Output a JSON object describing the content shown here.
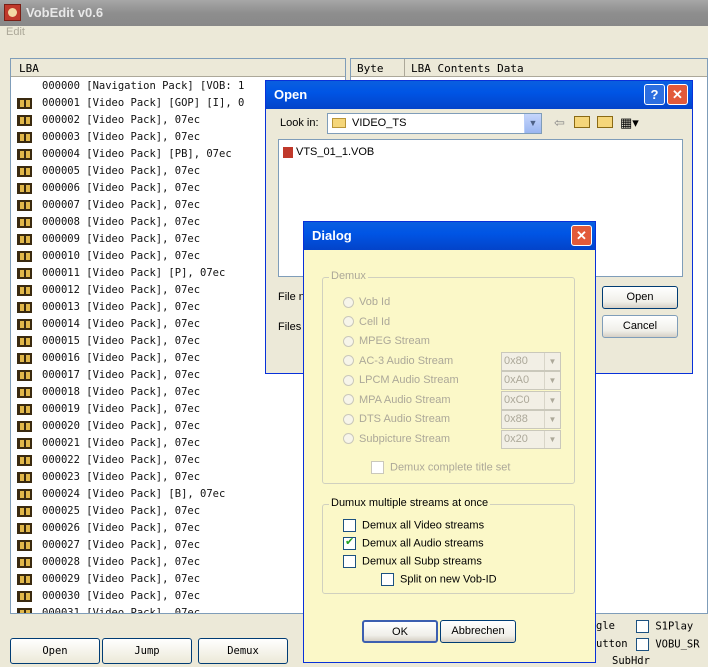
{
  "app": {
    "title": "VobEdit v0.6",
    "menu": [
      "Edit"
    ]
  },
  "list": {
    "header": "LBA",
    "rows": [
      "000000 [Navigation Pack] [VOB: 1",
      "000001 [Video Pack] [GOP] [I], 0",
      "000002 [Video Pack], 07ec",
      "000003 [Video Pack], 07ec",
      "000004 [Video Pack] [PB], 07ec",
      "000005 [Video Pack], 07ec",
      "000006 [Video Pack], 07ec",
      "000007 [Video Pack], 07ec",
      "000008 [Video Pack], 07ec",
      "000009 [Video Pack], 07ec",
      "000010 [Video Pack], 07ec",
      "000011 [Video Pack] [P], 07ec",
      "000012 [Video Pack], 07ec",
      "000013 [Video Pack], 07ec",
      "000014 [Video Pack], 07ec",
      "000015 [Video Pack], 07ec",
      "000016 [Video Pack], 07ec",
      "000017 [Video Pack], 07ec",
      "000018 [Video Pack], 07ec",
      "000019 [Video Pack], 07ec",
      "000020 [Video Pack], 07ec",
      "000021 [Video Pack], 07ec",
      "000022 [Video Pack], 07ec",
      "000023 [Video Pack], 07ec",
      "000024 [Video Pack] [B], 07ec",
      "000025 [Video Pack], 07ec",
      "000026 [Video Pack], 07ec",
      "000027 [Video Pack], 07ec",
      "000028 [Video Pack], 07ec",
      "000029 [Video Pack], 07ec",
      "000030 [Video Pack], 07ec",
      "000031 [Video Pack], 07ec"
    ]
  },
  "right_pane": {
    "col_byte": "Byte",
    "col_contents": "LBA Contents Data"
  },
  "bottom": {
    "buttons": [
      "Open",
      "Jump",
      "Demux"
    ],
    "checks": [
      {
        "label": "gle",
        "partial": true
      },
      {
        "label": "S1Play",
        "checked": false
      },
      {
        "label": "utton",
        "partial": true
      },
      {
        "label": "VOBU_SR",
        "checked": false
      },
      {
        "label": "SubHdr",
        "partial": true
      }
    ]
  },
  "open_dialog": {
    "title": "Open",
    "look_in_label": "Look in:",
    "look_in_value": "VIDEO_TS",
    "files": [
      "VTS_01_1.VOB"
    ],
    "file_name_label": "File n",
    "files_type_label": "Files o",
    "open_button": "Open",
    "cancel_button": "Cancel",
    "help_glyph": "?",
    "close_glyph": "✕"
  },
  "dialog": {
    "title": "Dialog",
    "demux_group": "Demux",
    "options": [
      {
        "label": "Vob Id"
      },
      {
        "label": "Cell Id"
      },
      {
        "label": "MPEG Stream"
      },
      {
        "label": "AC-3 Audio Stream",
        "value": "0x80"
      },
      {
        "label": "LPCM Audio Stream",
        "value": "0xA0"
      },
      {
        "label": "MPA Audio Stream",
        "value": "0xC0"
      },
      {
        "label": "DTS Audio Stream",
        "value": "0x88"
      },
      {
        "label": "Subpicture Stream",
        "value": "0x20"
      }
    ],
    "demux_complete": "Demux complete title set",
    "multi_group": "Dumux multiple streams at once",
    "multi": [
      {
        "label": "Demux all Video streams",
        "checked": false
      },
      {
        "label": "Demux all Audio streams",
        "checked": true
      },
      {
        "label": "Demux all Subp streams",
        "checked": false
      }
    ],
    "split": {
      "label": "Split on new Vob-ID",
      "checked": false
    },
    "ok_button": "OK",
    "abort_button": "Abbrechen",
    "close_glyph": "✕"
  }
}
